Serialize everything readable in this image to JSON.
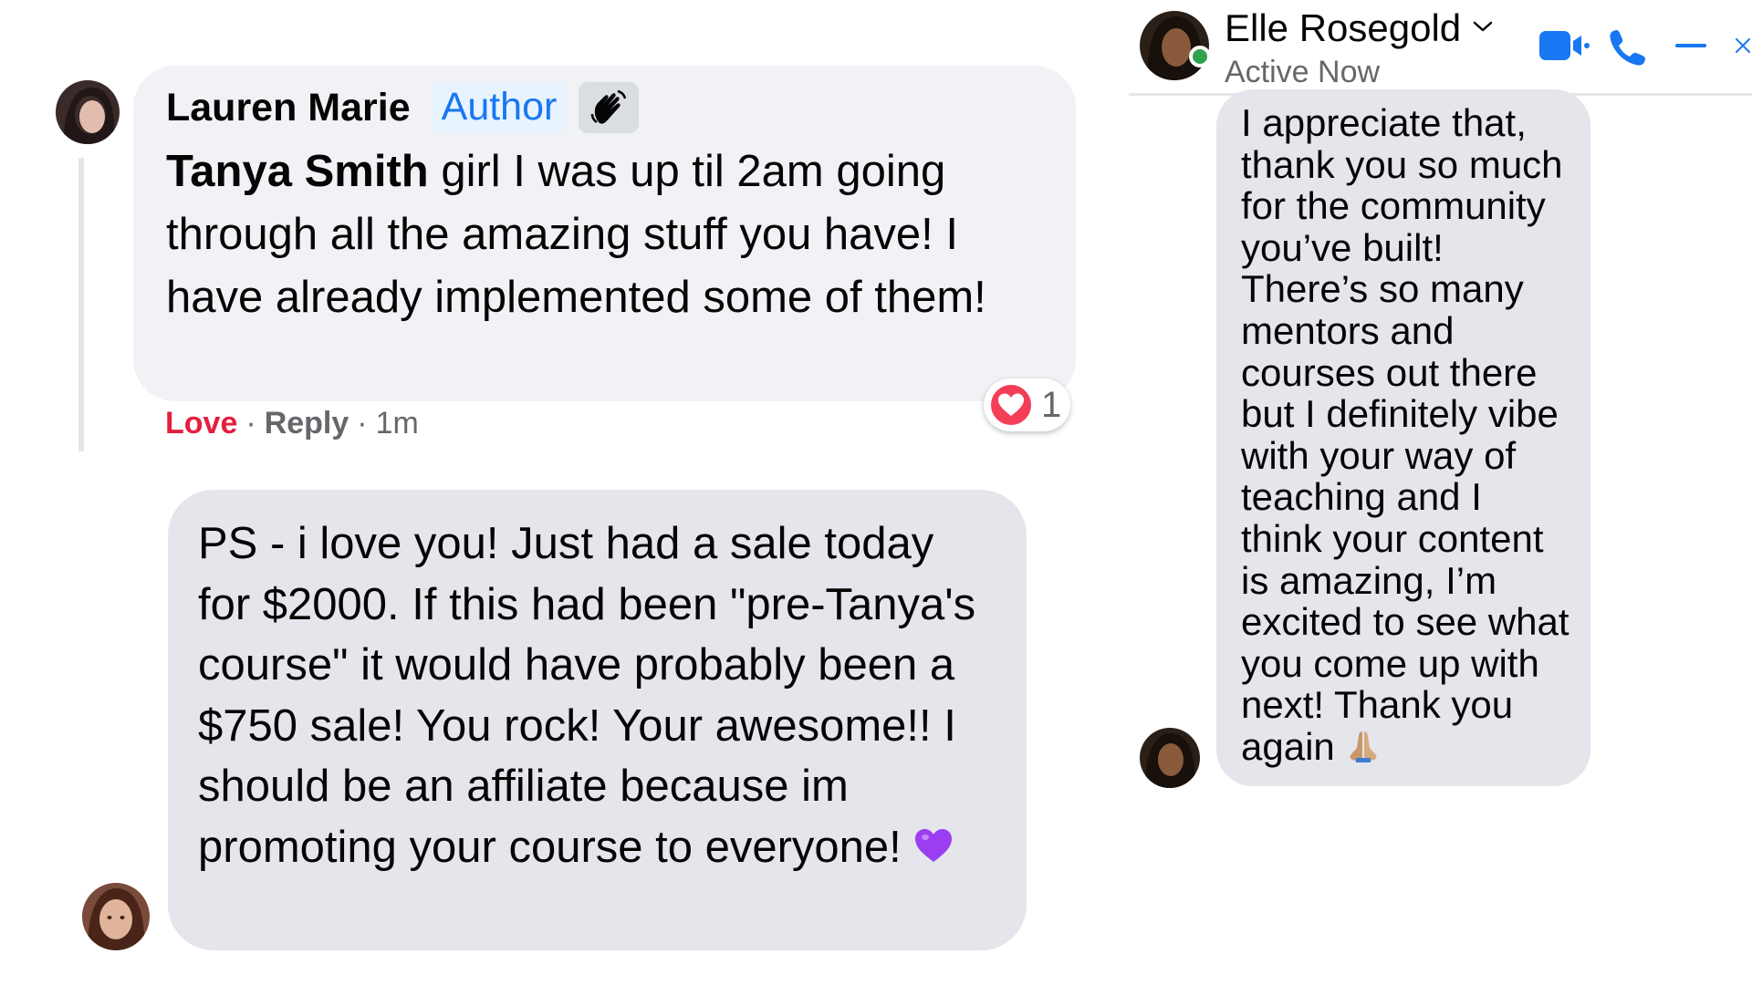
{
  "comment_1": {
    "author": "Lauren Marie",
    "badge": "Author",
    "badge_icon": "waving-hand-icon",
    "mention": "Tanya Smith",
    "text": " girl I was up til 2am going through all the amazing stuff you have! I have already implemented some of them!",
    "actions": {
      "reaction_label": "Love",
      "reply_label": "Reply",
      "separator": "·",
      "time": "1m"
    },
    "reactions": {
      "icon": "heart-icon",
      "count": "1"
    }
  },
  "comment_2": {
    "text": "PS - i love you! Just had a sale today for $2000. If this had been \"pre-Tanya's course\" it would have probably been a $750 sale! You rock! Your awesome!! I should be an affiliate because im promoting your course to everyone!",
    "emoji": "purple-heart-icon"
  },
  "messenger": {
    "contact_name": "Elle Rosegold",
    "status": "Active Now",
    "header_icons": [
      "video-call-icon",
      "phone-icon",
      "minimize-icon",
      "close-icon"
    ],
    "message": "I appreciate that, thank you so much for the community you’ve built! There’s so many mentors and courses out there but I definitely vibe with your way of teaching and I think your content is amazing, I’m excited to see what you come up with next! Thank you again",
    "emoji": "folded-hands-icon"
  },
  "colors": {
    "brand_blue": "#1877f2",
    "love_red": "#e41e3f",
    "online_green": "#31a24c",
    "bubble_gray": "#e4e6eb",
    "secondary_text": "#65676b"
  }
}
